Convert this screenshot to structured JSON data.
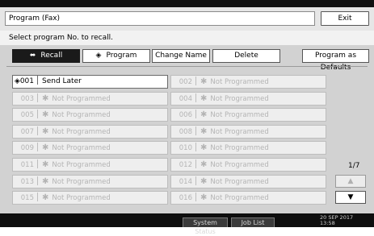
{
  "header": {
    "title": "Program (Fax)",
    "exit_label": "Exit"
  },
  "prompt": "Select program No. to recall.",
  "tabs": [
    {
      "label": "Recall",
      "icon": "recall-icon",
      "active": true
    },
    {
      "label": "Program",
      "icon": "program-icon",
      "active": false
    },
    {
      "label": "Change Name",
      "active": false
    },
    {
      "label": "Delete",
      "active": false
    },
    {
      "label": "Program as Defaults",
      "active": false
    }
  ],
  "programs": [
    {
      "num": "001",
      "name": "Send Later",
      "programmed": true,
      "icon": "programmed-icon"
    },
    {
      "num": "002",
      "name": "Not Programmed",
      "programmed": false
    },
    {
      "num": "003",
      "name": "Not Programmed",
      "programmed": false
    },
    {
      "num": "004",
      "name": "Not Programmed",
      "programmed": false
    },
    {
      "num": "005",
      "name": "Not Programmed",
      "programmed": false
    },
    {
      "num": "006",
      "name": "Not Programmed",
      "programmed": false
    },
    {
      "num": "007",
      "name": "Not Programmed",
      "programmed": false
    },
    {
      "num": "008",
      "name": "Not Programmed",
      "programmed": false
    },
    {
      "num": "009",
      "name": "Not Programmed",
      "programmed": false
    },
    {
      "num": "010",
      "name": "Not Programmed",
      "programmed": false
    },
    {
      "num": "011",
      "name": "Not Programmed",
      "programmed": false
    },
    {
      "num": "012",
      "name": "Not Programmed",
      "programmed": false
    },
    {
      "num": "013",
      "name": "Not Programmed",
      "programmed": false
    },
    {
      "num": "014",
      "name": "Not Programmed",
      "programmed": false
    },
    {
      "num": "015",
      "name": "Not Programmed",
      "programmed": false
    },
    {
      "num": "016",
      "name": "Not Programmed",
      "programmed": false
    }
  ],
  "pagination": {
    "indicator": "1/7",
    "up_icon": "arrow-up-icon",
    "down_icon": "arrow-down-icon"
  },
  "status_bar": {
    "system_status_label": "System Status",
    "job_list_label": "Job List",
    "date": "20 SEP  2017",
    "time": "13:58"
  }
}
